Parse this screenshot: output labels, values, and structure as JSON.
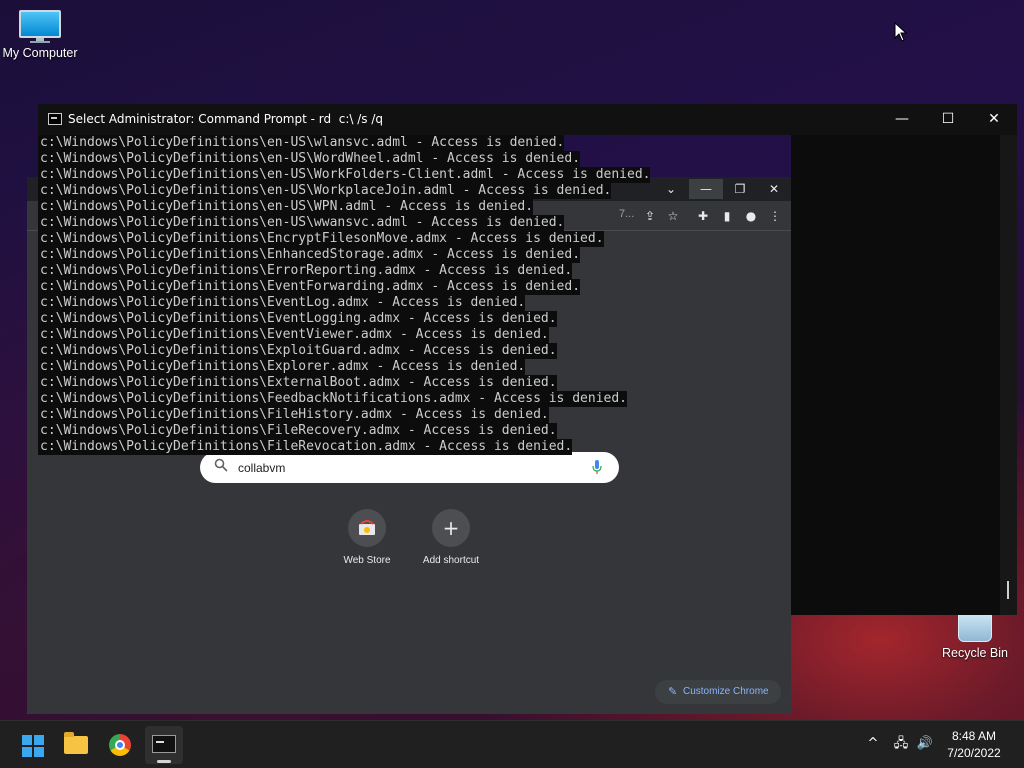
{
  "desktop": {
    "icons": [
      {
        "label": "My Computer",
        "icon": "computer-icon"
      },
      {
        "label": "Recycle Bin",
        "icon": "recycle-bin-icon"
      }
    ]
  },
  "cmd": {
    "title": "Select Administrator: Command Prompt - rd  c:\\ /s /q",
    "minimize": "—",
    "maximize": "☐",
    "close": "✕",
    "lines": [
      "c:\\Windows\\PolicyDefinitions\\en-US\\wlansvc.adml - Access is denied.",
      "c:\\Windows\\PolicyDefinitions\\en-US\\WordWheel.adml - Access is denied.",
      "c:\\Windows\\PolicyDefinitions\\en-US\\WorkFolders-Client.adml - Access is denied.",
      "c:\\Windows\\PolicyDefinitions\\en-US\\WorkplaceJoin.adml - Access is denied.",
      "c:\\Windows\\PolicyDefinitions\\en-US\\WPN.adml - Access is denied.",
      "c:\\Windows\\PolicyDefinitions\\en-US\\wwansvc.adml - Access is denied.",
      "c:\\Windows\\PolicyDefinitions\\EncryptFilesonMove.admx - Access is denied.",
      "c:\\Windows\\PolicyDefinitions\\EnhancedStorage.admx - Access is denied.",
      "c:\\Windows\\PolicyDefinitions\\ErrorReporting.admx - Access is denied.",
      "c:\\Windows\\PolicyDefinitions\\EventForwarding.admx - Access is denied.",
      "c:\\Windows\\PolicyDefinitions\\EventLog.admx - Access is denied.",
      "c:\\Windows\\PolicyDefinitions\\EventLogging.admx - Access is denied.",
      "c:\\Windows\\PolicyDefinitions\\EventViewer.admx - Access is denied.",
      "c:\\Windows\\PolicyDefinitions\\ExploitGuard.admx - Access is denied.",
      "c:\\Windows\\PolicyDefinitions\\Explorer.admx - Access is denied.",
      "c:\\Windows\\PolicyDefinitions\\ExternalBoot.admx - Access is denied.",
      "c:\\Windows\\PolicyDefinitions\\FeedbackNotifications.admx - Access is denied.",
      "c:\\Windows\\PolicyDefinitions\\FileHistory.admx - Access is denied.",
      "c:\\Windows\\PolicyDefinitions\\FileRecovery.admx - Access is denied.",
      "c:\\Windows\\PolicyDefinitions\\FileRevocation.admx - Access is denied."
    ]
  },
  "chrome": {
    "titlebar": {
      "dropdown": "⌄",
      "minimize": "—",
      "restore": "❐",
      "close": "✕"
    },
    "omnibox_fragment": "7...",
    "search": {
      "value": "collabvm"
    },
    "shortcuts": [
      {
        "label": "Web Store",
        "icon": "web-store-icon"
      },
      {
        "label": "Add shortcut",
        "icon": "plus-icon",
        "glyph": "+"
      }
    ],
    "customize_label": "Customize Chrome"
  },
  "taskbar": {
    "apps": [
      "start-icon",
      "file-explorer-icon",
      "chrome-icon",
      "terminal-icon"
    ],
    "tray": {
      "chevron": "^",
      "network": "🖧",
      "volume": "🔊"
    },
    "time": "8:48 AM",
    "date": "7/20/2022"
  }
}
